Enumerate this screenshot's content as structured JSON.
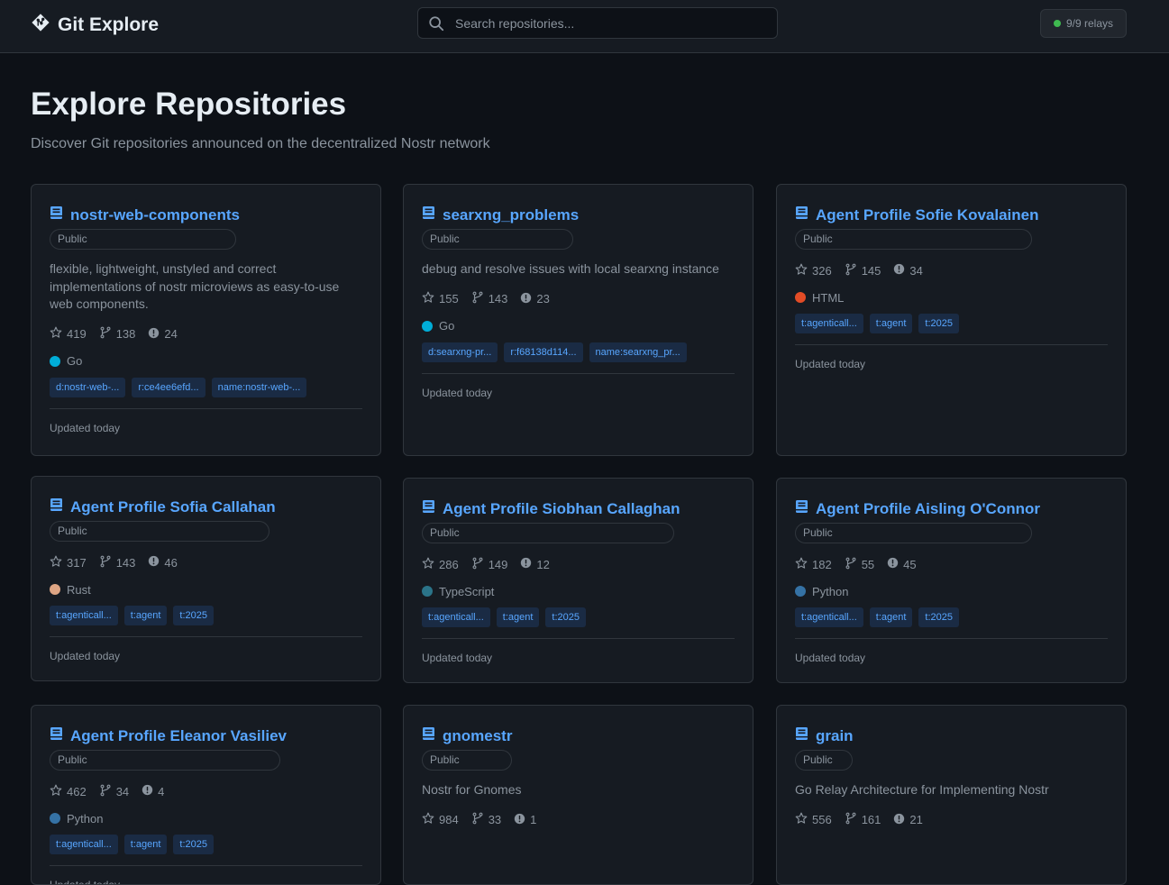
{
  "app": {
    "title": "Git Explore"
  },
  "search": {
    "placeholder": "Search repositories..."
  },
  "relays": {
    "label": "9/9 relays",
    "status_color": "#3fb950"
  },
  "page": {
    "title": "Explore Repositories",
    "subtitle": "Discover Git repositories announced on the decentralized Nostr network"
  },
  "repos": [
    {
      "name": "nostr-web-components",
      "visibility": "Public",
      "description": "flexible, lightweight, unstyled and correct implementations of nostr microviews as easy-to-use web components.",
      "stars": "419",
      "forks": "138",
      "issues": "24",
      "language": "Go",
      "language_color": "#00add8",
      "tags": [
        "d:nostr-web-...",
        "r:ce4ee6efd...",
        "name:nostr-web-..."
      ],
      "updated": "Updated today"
    },
    {
      "name": "searxng_problems",
      "visibility": "Public",
      "description": "debug and resolve issues with local searxng instance",
      "stars": "155",
      "forks": "143",
      "issues": "23",
      "language": "Go",
      "language_color": "#00add8",
      "tags": [
        "d:searxng-pr...",
        "r:f68138d114...",
        "name:searxng_pr..."
      ],
      "updated": "Updated today"
    },
    {
      "name": "Agent Profile Sofie Kovalainen",
      "visibility": "Public",
      "description": "",
      "stars": "326",
      "forks": "145",
      "issues": "34",
      "language": "HTML",
      "language_color": "#e34c26",
      "tags": [
        "t:agenticall...",
        "t:agent",
        "t:2025"
      ],
      "updated": "Updated today"
    },
    {
      "name": "Agent Profile Sofia Callahan",
      "visibility": "Public",
      "description": "",
      "stars": "317",
      "forks": "143",
      "issues": "46",
      "language": "Rust",
      "language_color": "#dea584",
      "tags": [
        "t:agenticall...",
        "t:agent",
        "t:2025"
      ],
      "updated": "Updated today"
    },
    {
      "name": "Agent Profile Siobhan Callaghan",
      "visibility": "Public",
      "description": "",
      "stars": "286",
      "forks": "149",
      "issues": "12",
      "language": "TypeScript",
      "language_color": "#2b7489",
      "tags": [
        "t:agenticall...",
        "t:agent",
        "t:2025"
      ],
      "updated": "Updated today"
    },
    {
      "name": "Agent Profile Aisling O'Connor",
      "visibility": "Public",
      "description": "",
      "stars": "182",
      "forks": "55",
      "issues": "45",
      "language": "Python",
      "language_color": "#3572a5",
      "tags": [
        "t:agenticall...",
        "t:agent",
        "t:2025"
      ],
      "updated": "Updated today"
    },
    {
      "name": "Agent Profile Eleanor Vasiliev",
      "visibility": "Public",
      "description": "",
      "stars": "462",
      "forks": "34",
      "issues": "4",
      "language": "Python",
      "language_color": "#3572a5",
      "tags": [
        "t:agenticall...",
        "t:agent",
        "t:2025"
      ],
      "updated": "Updated today"
    },
    {
      "name": "gnomestr",
      "visibility": "Public",
      "description": "Nostr for Gnomes",
      "stars": "984",
      "forks": "33",
      "issues": "1",
      "language": "",
      "language_color": "",
      "tags": [],
      "updated": ""
    },
    {
      "name": "grain",
      "visibility": "Public",
      "description": "Go Relay Architecture for Implementing Nostr",
      "stars": "556",
      "forks": "161",
      "issues": "21",
      "language": "",
      "language_color": "",
      "tags": [],
      "updated": ""
    }
  ]
}
